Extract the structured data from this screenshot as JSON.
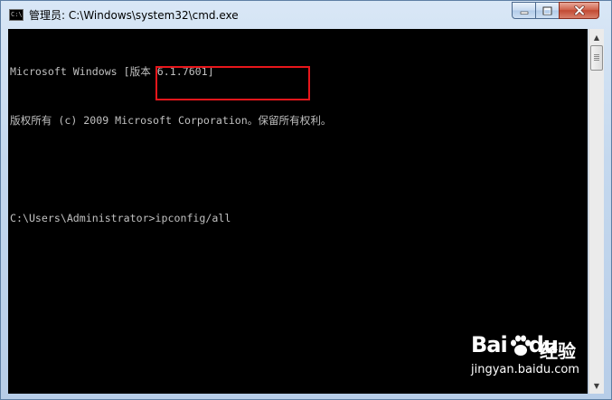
{
  "window": {
    "title": "管理员: C:\\Windows\\system32\\cmd.exe",
    "icon": "cmd-icon",
    "icon_label": "C:\\"
  },
  "controls": {
    "minimize_icon": "minimize-icon",
    "maximize_icon": "maximize-icon",
    "close_icon": "close-icon"
  },
  "console": {
    "lines": [
      "Microsoft Windows [版本 6.1.7601]",
      "版权所有 (c) 2009 Microsoft Corporation。保留所有权利。",
      "",
      "C:\\Users\\Administrator>ipconfig/all"
    ]
  },
  "scrollbar": {
    "position": 0
  },
  "watermark": {
    "brand_prefix": "Bai",
    "brand_suffix": "du",
    "product": "经验",
    "url": "jingyan.baidu.com"
  },
  "colors": {
    "console_text": "#c0c0c0",
    "console_bg": "#000000",
    "highlight": "#e8161b"
  }
}
